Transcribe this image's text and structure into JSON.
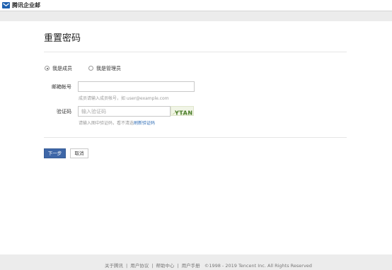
{
  "brand": {
    "name": "腾讯企业邮",
    "color": "#1f61b0"
  },
  "page": {
    "title": "重置密码"
  },
  "roles": [
    {
      "label": "我是成员",
      "checked": true
    },
    {
      "label": "我是管理员",
      "checked": false
    }
  ],
  "form": {
    "email": {
      "label": "邮箱帐号",
      "value": "",
      "hint": "成员请输入成员帐号，如 user@example.com"
    },
    "captcha": {
      "label": "验证码",
      "placeholder": "输入验证码",
      "hint_prefix": "请输入图中验证码，看不清选",
      "refresh_link": "刷新验证码",
      "image_text": "YTAN"
    }
  },
  "actions": {
    "next": "下一步",
    "cancel": "取消"
  },
  "footer": {
    "links": [
      "关于腾讯",
      "用户协议",
      "帮助中心",
      "用户手册"
    ],
    "copyright": "©1998 - 2019 Tencent Inc. All Rights Reserved"
  }
}
